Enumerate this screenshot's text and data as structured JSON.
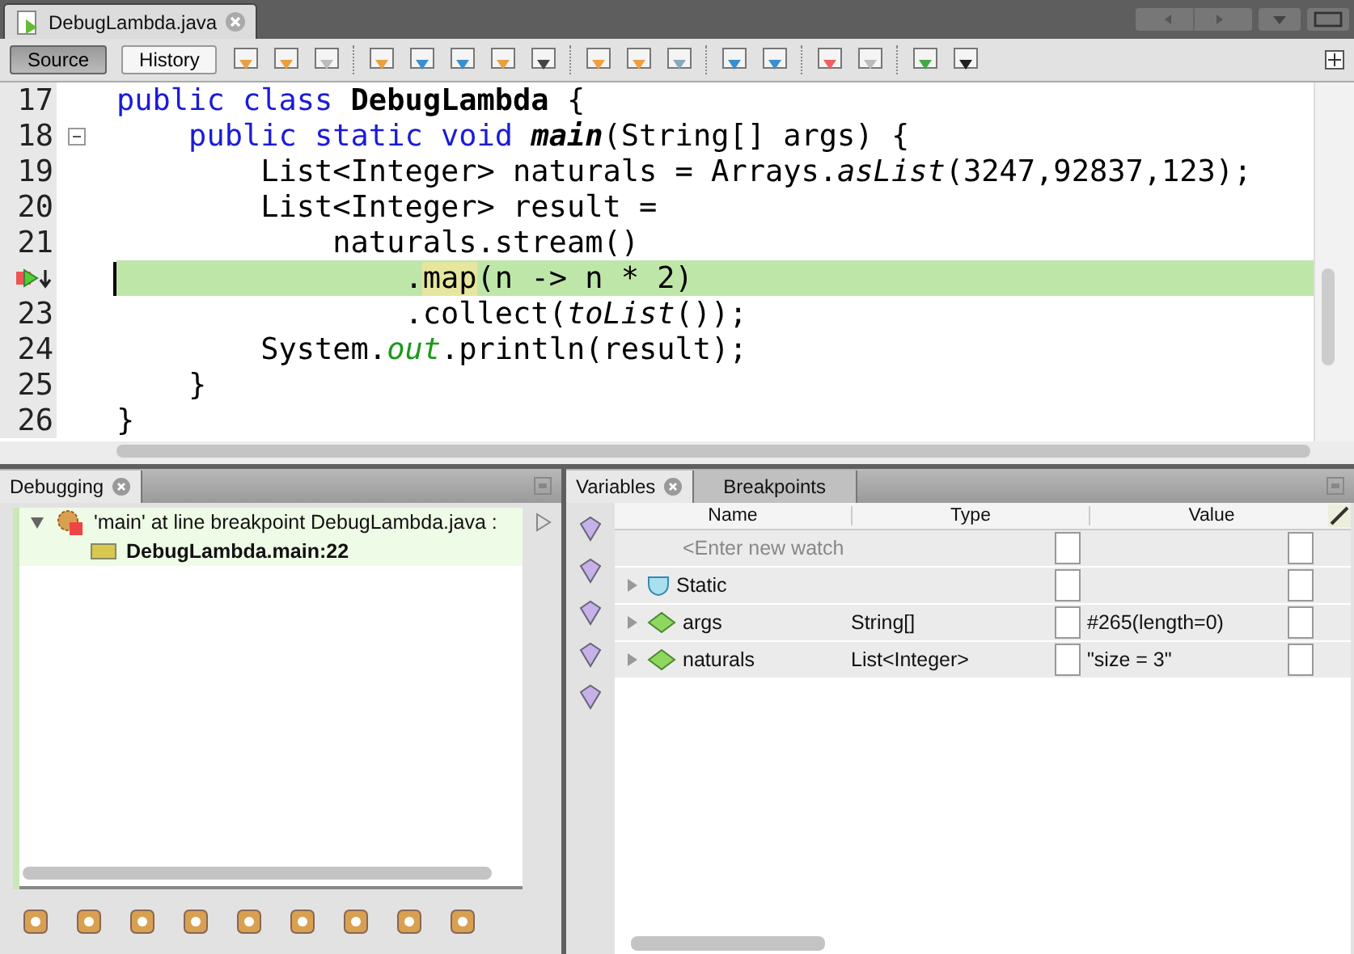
{
  "editor_tabs": [
    {
      "title": "DebugLambda.java",
      "selected": true
    }
  ],
  "view_buttons": [
    {
      "label": "Source",
      "selected": true
    },
    {
      "label": "History",
      "selected": false
    }
  ],
  "code_lines": [
    {
      "number": "17",
      "current": false,
      "fold": false,
      "tokens": [
        {
          "text": "public class ",
          "kind": "keyword"
        },
        {
          "text": "DebugLambda",
          "kind": "bold"
        },
        {
          "text": " {",
          "kind": "plain"
        }
      ]
    },
    {
      "number": "18",
      "current": false,
      "fold": true,
      "tokens": [
        {
          "text": "    public static void ",
          "kind": "keyword"
        },
        {
          "text": "main",
          "kind": "bold-italic"
        },
        {
          "text": "(String[] args) {",
          "kind": "plain"
        }
      ]
    },
    {
      "number": "19",
      "current": false,
      "fold": false,
      "tokens": [
        {
          "text": "        List<Integer> naturals = Arrays.",
          "kind": "plain"
        },
        {
          "text": "asList",
          "kind": "italic"
        },
        {
          "text": "(3247,92837,123);",
          "kind": "plain"
        }
      ]
    },
    {
      "number": "20",
      "current": false,
      "fold": false,
      "tokens": [
        {
          "text": "        List<Integer> result =",
          "kind": "plain"
        }
      ]
    },
    {
      "number": "21",
      "current": false,
      "fold": false,
      "tokens": [
        {
          "text": "            naturals.stream()",
          "kind": "plain"
        }
      ]
    },
    {
      "current": true,
      "fold": false,
      "tokens": [
        {
          "text": "                .",
          "kind": "plain"
        },
        {
          "text": "map",
          "kind": "highlight"
        },
        {
          "text": "(n -> n * 2)",
          "kind": "plain"
        }
      ]
    },
    {
      "number": "23",
      "current": false,
      "fold": false,
      "tokens": [
        {
          "text": "                .collect(",
          "kind": "plain"
        },
        {
          "text": "toList",
          "kind": "italic"
        },
        {
          "text": "());",
          "kind": "plain"
        }
      ]
    },
    {
      "number": "24",
      "current": false,
      "fold": false,
      "tokens": [
        {
          "text": "        System.",
          "kind": "plain"
        },
        {
          "text": "out",
          "kind": "static"
        },
        {
          "text": ".println(result);",
          "kind": "plain"
        }
      ]
    },
    {
      "number": "25",
      "current": false,
      "fold": false,
      "tokens": [
        {
          "text": "    }",
          "kind": "plain"
        }
      ]
    },
    {
      "number": "26",
      "current": false,
      "fold": false,
      "tokens": [
        {
          "text": "}",
          "kind": "plain"
        }
      ]
    }
  ],
  "debugging": {
    "title": "Debugging",
    "threads": [
      {
        "label": "'main' at line breakpoint DebugLambda.java :",
        "expanded": true,
        "children": [
          {
            "label": "DebugLambda.main:22",
            "current": true
          }
        ]
      }
    ]
  },
  "variables": {
    "tabs": [
      {
        "label": "Variables",
        "selected": true
      },
      {
        "label": "Breakpoints",
        "selected": false
      }
    ],
    "columns": [
      "Name",
      "Type",
      "Value"
    ],
    "watch_placeholder": "<Enter new watch",
    "rows": [
      {
        "name": "Static",
        "kind": "static"
      },
      {
        "name": "args",
        "kind": "field",
        "type": "String[]",
        "value": "#265(length=0)"
      },
      {
        "name": "naturals",
        "kind": "field",
        "type": "List<Integer>",
        "value": "\"size = 3\""
      }
    ]
  }
}
